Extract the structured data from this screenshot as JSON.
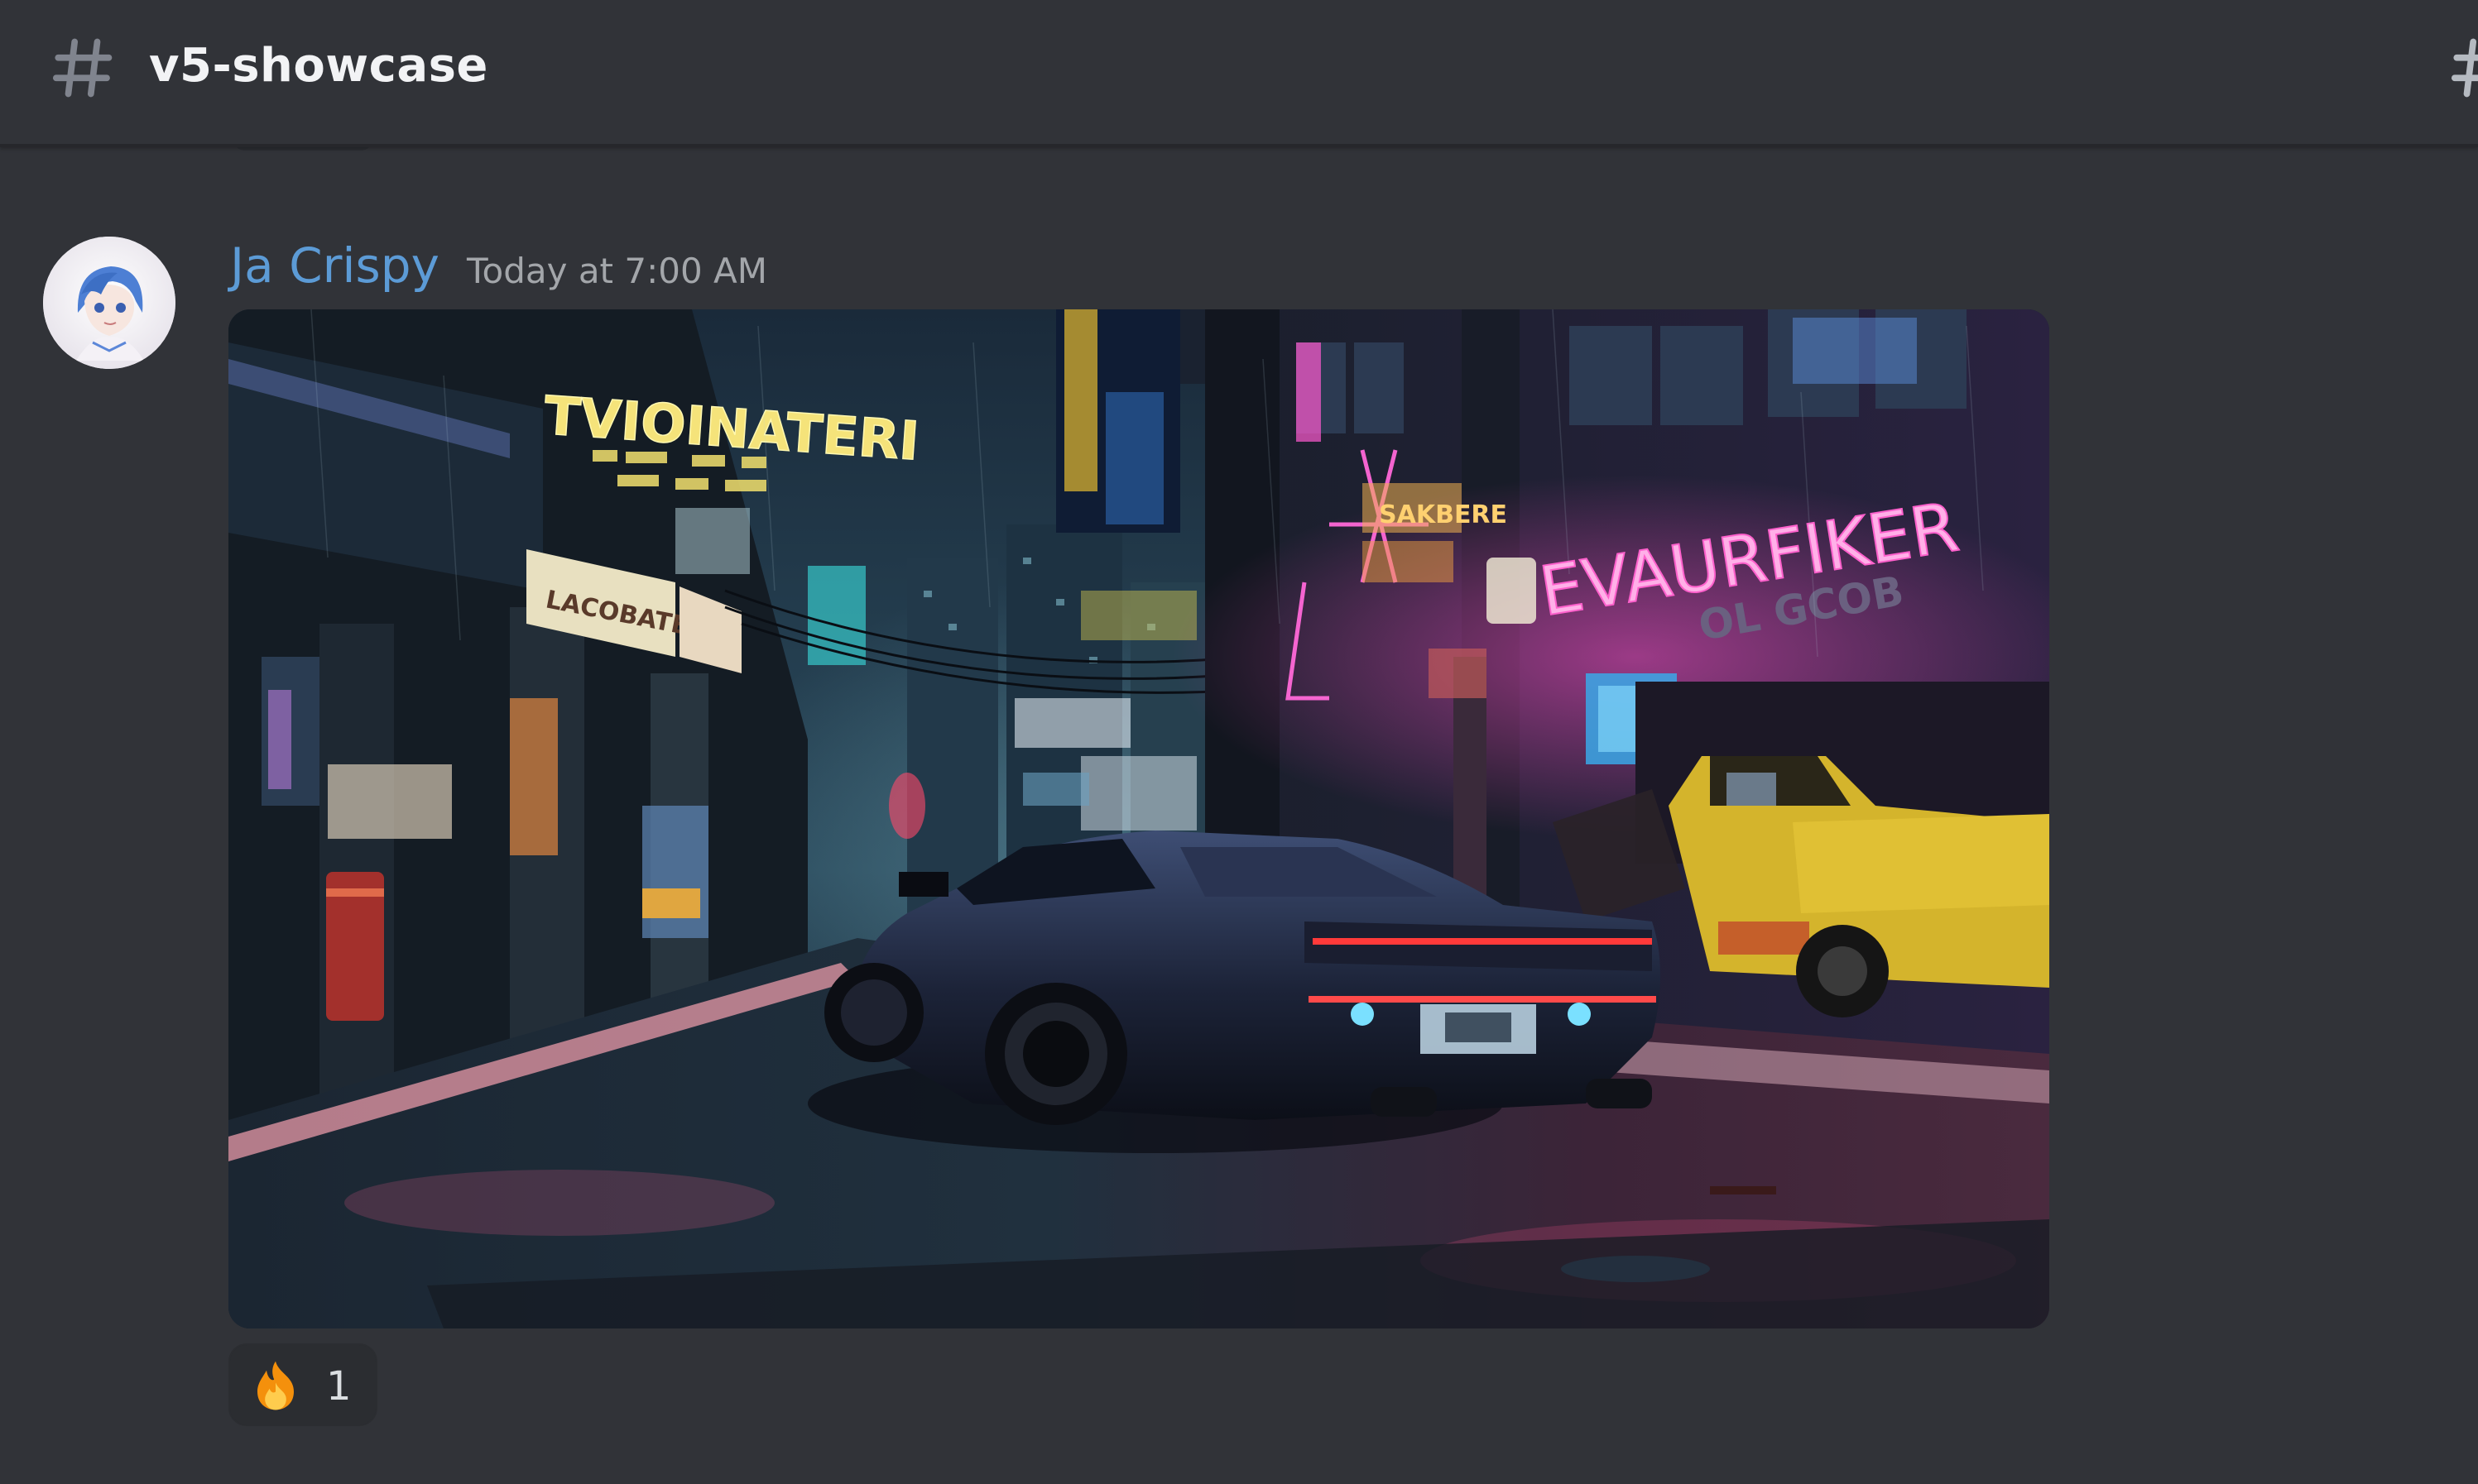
{
  "channel": {
    "name": "v5-showcase",
    "icon": "hash-icon"
  },
  "message": {
    "author": "Ja Crispy",
    "timestamp": "Today at 7:00 AM",
    "author_color": "#5c9bd6",
    "attachment": {
      "kind": "image",
      "description_icon": "cyberpunk-street-image",
      "signs": {
        "yellow_sign": "TVIOINATERI",
        "pink_sign": "EVAURFIKER",
        "sub_sign": "OL GCOB",
        "awning_sign": "LACOBATEE",
        "shop_sign_small": "SAKBERE"
      }
    },
    "reactions": [
      {
        "emoji": "fire-icon",
        "count": "1"
      }
    ]
  },
  "colors": {
    "background": "#313338",
    "header_text": "#f2f3f5",
    "timestamp": "#a3a6aa",
    "reaction_bg": "#2b2d31"
  }
}
